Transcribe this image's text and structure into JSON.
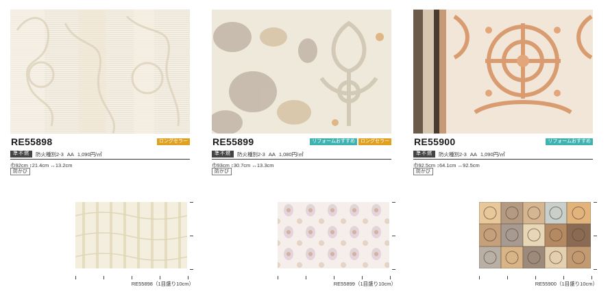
{
  "products": [
    {
      "code": "RE55898",
      "badges": [
        {
          "label": "ロングセラー",
          "color": "orange"
        }
      ],
      "tag": "準不燃",
      "fire": "防火種別2-3",
      "grade": "AA",
      "price": "1,090円/㎡",
      "width": "巾92cm",
      "vertical": "↕21.4cm",
      "horizontal": "↔13.2cm",
      "feature": "防かび",
      "sample_caption": "RE55898（1目盛り10cm）"
    },
    {
      "code": "RE55899",
      "badges": [
        {
          "label": "リフォームおすすめ",
          "color": "teal"
        },
        {
          "label": "ロングセラー",
          "color": "orange"
        }
      ],
      "tag": "準不燃",
      "fire": "防火種別2-3",
      "grade": "AA",
      "price": "1,080円/㎡",
      "width": "巾93cm",
      "vertical": "↕30.7cm",
      "horizontal": "↔13.3cm",
      "feature": "防かび",
      "sample_caption": "RE55899（1目盛り10cm）"
    },
    {
      "code": "RE55900",
      "badges": [
        {
          "label": "リフォームおすすめ",
          "color": "teal"
        }
      ],
      "tag": "準不燃",
      "fire": "防火種別2-3",
      "grade": "AA",
      "price": "1,090円/㎡",
      "width": "巾92.5cm",
      "vertical": "↕64.1cm",
      "horizontal": "↔92.5cm",
      "feature": "防かび",
      "sample_caption": "RE55900（1目盛り10cm）"
    }
  ],
  "colors": {
    "badge_orange": "#e0a020",
    "badge_teal": "#3fb3b0",
    "tag_dark": "#444444"
  }
}
